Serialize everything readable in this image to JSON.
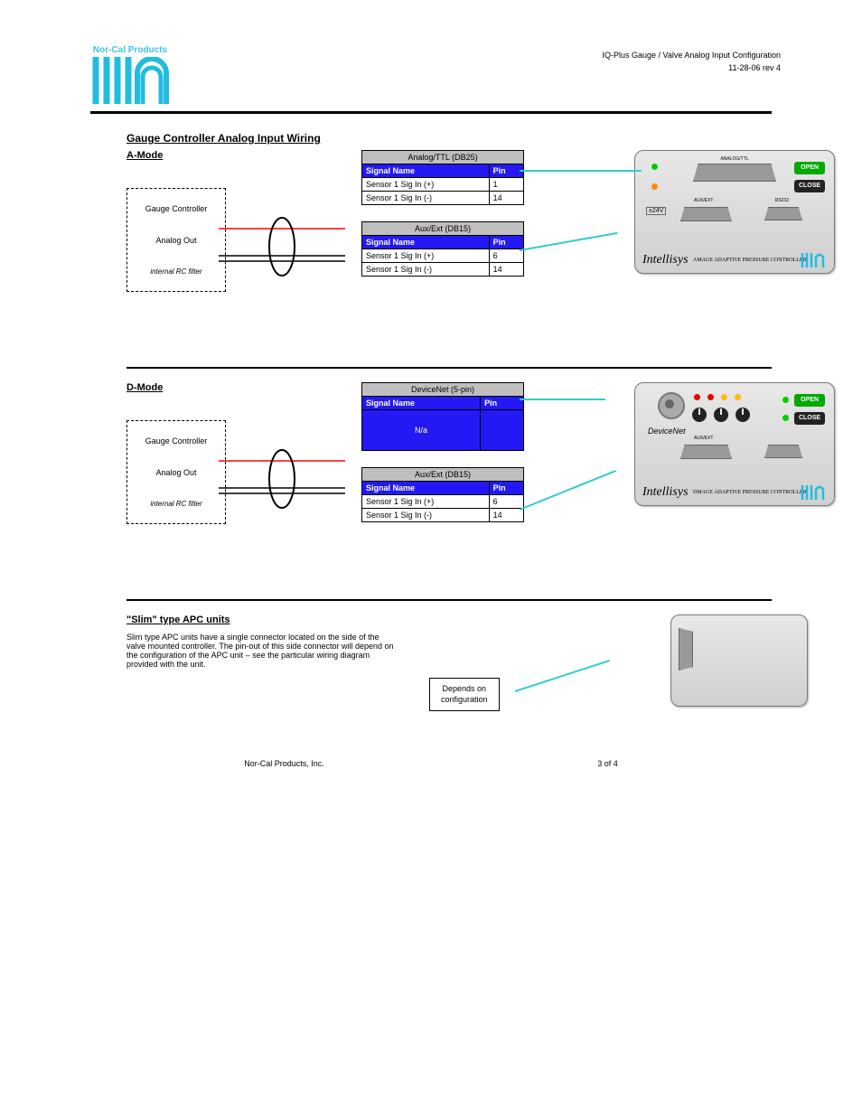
{
  "header": {
    "company": "Nor-Cal Products",
    "title_line1": "IQ-Plus Gauge / Valve Analog Input Configuration",
    "title_line2": "11-28-06 rev 4"
  },
  "section1_title": "Gauge Controller Analog Input Wiring",
  "mode_a": {
    "title": "A-Mode",
    "switch_top": "Gauge Controller",
    "switch_mid": "Analog Out",
    "switch_bot": "internal RC filter",
    "table1_caption": "Analog/TTL (DB25)",
    "table2_caption": "Aux/Ext (DB15)"
  },
  "mode_d": {
    "title": "D-Mode",
    "switch_top": "Gauge Controller",
    "switch_mid": "Analog Out",
    "switch_bot": "internal RC filter",
    "table1_caption": "DeviceNet (5-pin)",
    "table1_note": "N/a",
    "table2_caption": "Aux/Ext (DB15)"
  },
  "pin_header_left": "Signal Name",
  "pin_header_right": "Pin",
  "pin_a_t1": [
    {
      "name": "Sensor 1 Sig In (+)",
      "pin": "1"
    },
    {
      "name": "Sensor 1 Sig In (-)",
      "pin": "14"
    }
  ],
  "pin_a_t2": [
    {
      "name": "Sensor 1 Sig In (+)",
      "pin": "6"
    },
    {
      "name": "Sensor 1 Sig In (-)",
      "pin": "14"
    }
  ],
  "pin_d_t2": [
    {
      "name": "Sensor 1 Sig In (+)",
      "pin": "6"
    },
    {
      "name": "Sensor 1 Sig In (-)",
      "pin": "14"
    }
  ],
  "section2_title": "\"Slim\" type APC units",
  "section2_body": "Slim type APC units have a single connector located on the side of the valve mounted controller. The pin-out of this side connector will depend on the configuration of the APC unit – see the particular wiring diagram provided with the unit.",
  "note_box_line1": "Depends on",
  "note_box_line2": "configuration",
  "device": {
    "brand": "Intellisys",
    "sub_a": "AMAGE\nADAPTIVE PRESSURE CONTROLLER",
    "sub_d": "DMAGE\nADAPTIVE PRESSURE CONTROLLER",
    "dnlabel": "DeviceNet",
    "btn_open": "OPEN",
    "btn_close": "CLOSE",
    "top_label": "ANALOG/TTL",
    "aux_label": "AUX/EXT",
    "rs_label": "RS232"
  },
  "footer": {
    "company": "Nor-Cal Products, Inc.",
    "page": "3 of 4"
  }
}
